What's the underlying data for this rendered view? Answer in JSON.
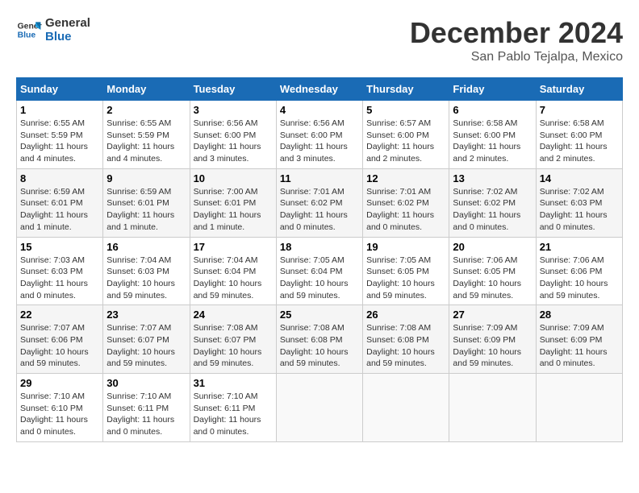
{
  "logo": {
    "line1": "General",
    "line2": "Blue"
  },
  "title": "December 2024",
  "location": "San Pablo Tejalpa, Mexico",
  "weekdays": [
    "Sunday",
    "Monday",
    "Tuesday",
    "Wednesday",
    "Thursday",
    "Friday",
    "Saturday"
  ],
  "weeks": [
    [
      {
        "day": "1",
        "info": "Sunrise: 6:55 AM\nSunset: 5:59 PM\nDaylight: 11 hours\nand 4 minutes."
      },
      {
        "day": "2",
        "info": "Sunrise: 6:55 AM\nSunset: 5:59 PM\nDaylight: 11 hours\nand 4 minutes."
      },
      {
        "day": "3",
        "info": "Sunrise: 6:56 AM\nSunset: 6:00 PM\nDaylight: 11 hours\nand 3 minutes."
      },
      {
        "day": "4",
        "info": "Sunrise: 6:56 AM\nSunset: 6:00 PM\nDaylight: 11 hours\nand 3 minutes."
      },
      {
        "day": "5",
        "info": "Sunrise: 6:57 AM\nSunset: 6:00 PM\nDaylight: 11 hours\nand 2 minutes."
      },
      {
        "day": "6",
        "info": "Sunrise: 6:58 AM\nSunset: 6:00 PM\nDaylight: 11 hours\nand 2 minutes."
      },
      {
        "day": "7",
        "info": "Sunrise: 6:58 AM\nSunset: 6:00 PM\nDaylight: 11 hours\nand 2 minutes."
      }
    ],
    [
      {
        "day": "8",
        "info": "Sunrise: 6:59 AM\nSunset: 6:01 PM\nDaylight: 11 hours\nand 1 minute."
      },
      {
        "day": "9",
        "info": "Sunrise: 6:59 AM\nSunset: 6:01 PM\nDaylight: 11 hours\nand 1 minute."
      },
      {
        "day": "10",
        "info": "Sunrise: 7:00 AM\nSunset: 6:01 PM\nDaylight: 11 hours\nand 1 minute."
      },
      {
        "day": "11",
        "info": "Sunrise: 7:01 AM\nSunset: 6:02 PM\nDaylight: 11 hours\nand 0 minutes."
      },
      {
        "day": "12",
        "info": "Sunrise: 7:01 AM\nSunset: 6:02 PM\nDaylight: 11 hours\nand 0 minutes."
      },
      {
        "day": "13",
        "info": "Sunrise: 7:02 AM\nSunset: 6:02 PM\nDaylight: 11 hours\nand 0 minutes."
      },
      {
        "day": "14",
        "info": "Sunrise: 7:02 AM\nSunset: 6:03 PM\nDaylight: 11 hours\nand 0 minutes."
      }
    ],
    [
      {
        "day": "15",
        "info": "Sunrise: 7:03 AM\nSunset: 6:03 PM\nDaylight: 11 hours\nand 0 minutes."
      },
      {
        "day": "16",
        "info": "Sunrise: 7:04 AM\nSunset: 6:03 PM\nDaylight: 10 hours\nand 59 minutes."
      },
      {
        "day": "17",
        "info": "Sunrise: 7:04 AM\nSunset: 6:04 PM\nDaylight: 10 hours\nand 59 minutes."
      },
      {
        "day": "18",
        "info": "Sunrise: 7:05 AM\nSunset: 6:04 PM\nDaylight: 10 hours\nand 59 minutes."
      },
      {
        "day": "19",
        "info": "Sunrise: 7:05 AM\nSunset: 6:05 PM\nDaylight: 10 hours\nand 59 minutes."
      },
      {
        "day": "20",
        "info": "Sunrise: 7:06 AM\nSunset: 6:05 PM\nDaylight: 10 hours\nand 59 minutes."
      },
      {
        "day": "21",
        "info": "Sunrise: 7:06 AM\nSunset: 6:06 PM\nDaylight: 10 hours\nand 59 minutes."
      }
    ],
    [
      {
        "day": "22",
        "info": "Sunrise: 7:07 AM\nSunset: 6:06 PM\nDaylight: 10 hours\nand 59 minutes."
      },
      {
        "day": "23",
        "info": "Sunrise: 7:07 AM\nSunset: 6:07 PM\nDaylight: 10 hours\nand 59 minutes."
      },
      {
        "day": "24",
        "info": "Sunrise: 7:08 AM\nSunset: 6:07 PM\nDaylight: 10 hours\nand 59 minutes."
      },
      {
        "day": "25",
        "info": "Sunrise: 7:08 AM\nSunset: 6:08 PM\nDaylight: 10 hours\nand 59 minutes."
      },
      {
        "day": "26",
        "info": "Sunrise: 7:08 AM\nSunset: 6:08 PM\nDaylight: 10 hours\nand 59 minutes."
      },
      {
        "day": "27",
        "info": "Sunrise: 7:09 AM\nSunset: 6:09 PM\nDaylight: 10 hours\nand 59 minutes."
      },
      {
        "day": "28",
        "info": "Sunrise: 7:09 AM\nSunset: 6:09 PM\nDaylight: 11 hours\nand 0 minutes."
      }
    ],
    [
      {
        "day": "29",
        "info": "Sunrise: 7:10 AM\nSunset: 6:10 PM\nDaylight: 11 hours\nand 0 minutes."
      },
      {
        "day": "30",
        "info": "Sunrise: 7:10 AM\nSunset: 6:11 PM\nDaylight: 11 hours\nand 0 minutes."
      },
      {
        "day": "31",
        "info": "Sunrise: 7:10 AM\nSunset: 6:11 PM\nDaylight: 11 hours\nand 0 minutes."
      },
      {
        "day": "",
        "info": ""
      },
      {
        "day": "",
        "info": ""
      },
      {
        "day": "",
        "info": ""
      },
      {
        "day": "",
        "info": ""
      }
    ]
  ]
}
